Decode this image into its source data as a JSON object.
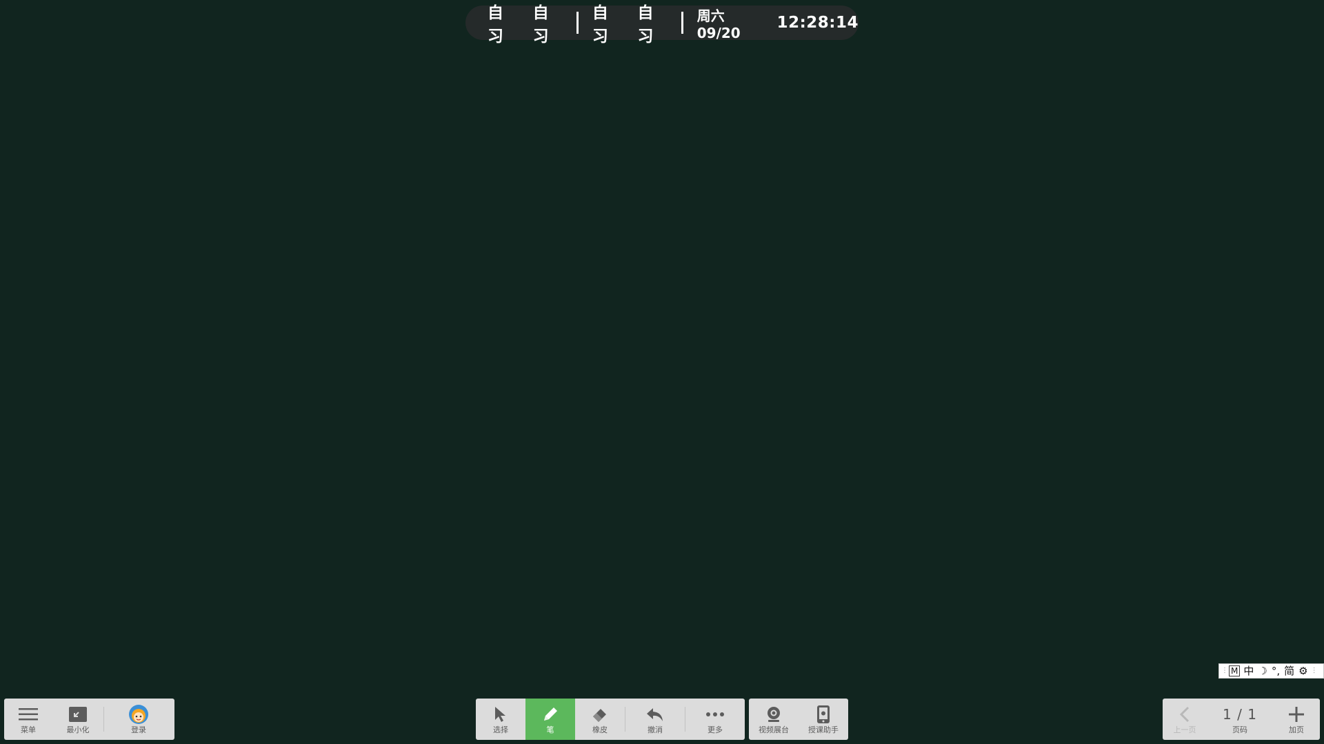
{
  "schedule": {
    "periods": [
      "自习",
      "自习",
      "自习",
      "自习"
    ],
    "date": "周六 09/20",
    "time": "12:28:14"
  },
  "left_toolbar": {
    "menu_label": "菜单",
    "minimize_label": "最小化",
    "login_label": "登录"
  },
  "center_toolbar": {
    "select_label": "选择",
    "pen_label": "笔",
    "eraser_label": "橡皮",
    "undo_label": "撤消",
    "more_label": "更多",
    "active_tool": "pen",
    "active_color": "#5cb85c"
  },
  "media_toolbar": {
    "video_booth_label": "视频展台",
    "teaching_assistant_label": "授课助手"
  },
  "right_toolbar": {
    "prev_label": "上一页",
    "page_indicator": "1 / 1",
    "page_label": "页码",
    "add_page_label": "加页"
  },
  "ime": {
    "mode": "M",
    "lang": "中",
    "halfwidth": "☽",
    "punct": "°,",
    "charset": "简",
    "settings_icon": "gear-icon"
  },
  "colors": {
    "board_background": "#11251f",
    "schedule_background": "#252a2a",
    "toolbar_background": "#dcdcdc",
    "accent": "#5cb85c"
  }
}
